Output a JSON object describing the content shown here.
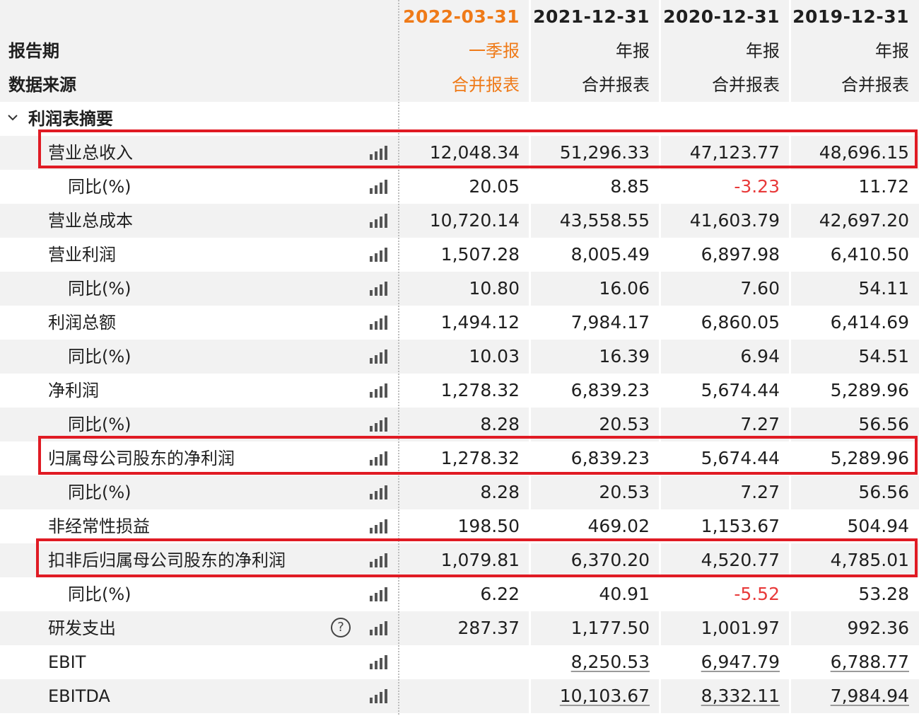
{
  "columns": [
    {
      "date": "2022-03-31",
      "report": "一季报",
      "source": "合并报表",
      "accent": true
    },
    {
      "date": "2021-12-31",
      "report": "年报",
      "source": "合并报表",
      "accent": false
    },
    {
      "date": "2020-12-31",
      "report": "年报",
      "source": "合并报表",
      "accent": false
    },
    {
      "date": "2019-12-31",
      "report": "年报",
      "source": "合并报表",
      "accent": false
    }
  ],
  "header": {
    "report_period_label": "报告期",
    "data_source_label": "数据来源",
    "section_label": "利润表摘要"
  },
  "rows": [
    {
      "label": "营业总收入",
      "values": [
        "12,048.34",
        "51,296.33",
        "47,123.77",
        "48,696.15"
      ]
    },
    {
      "label": "同比(%)",
      "values": [
        "20.05",
        "8.85",
        "-3.23",
        "11.72"
      ]
    },
    {
      "label": "营业总成本",
      "values": [
        "10,720.14",
        "43,558.55",
        "41,603.79",
        "42,697.20"
      ]
    },
    {
      "label": "营业利润",
      "values": [
        "1,507.28",
        "8,005.49",
        "6,897.98",
        "6,410.50"
      ]
    },
    {
      "label": "同比(%)",
      "values": [
        "10.80",
        "16.06",
        "7.60",
        "54.11"
      ]
    },
    {
      "label": "利润总额",
      "values": [
        "1,494.12",
        "7,984.17",
        "6,860.05",
        "6,414.69"
      ]
    },
    {
      "label": "同比(%)",
      "values": [
        "10.03",
        "16.39",
        "6.94",
        "54.51"
      ]
    },
    {
      "label": "净利润",
      "values": [
        "1,278.32",
        "6,839.23",
        "5,674.44",
        "5,289.96"
      ]
    },
    {
      "label": "同比(%)",
      "values": [
        "8.28",
        "20.53",
        "7.27",
        "56.56"
      ]
    },
    {
      "label": "归属母公司股东的净利润",
      "values": [
        "1,278.32",
        "6,839.23",
        "5,674.44",
        "5,289.96"
      ]
    },
    {
      "label": "同比(%)",
      "values": [
        "8.28",
        "20.53",
        "7.27",
        "56.56"
      ]
    },
    {
      "label": "非经常性损益",
      "values": [
        "198.50",
        "469.02",
        "1,153.67",
        "504.94"
      ]
    },
    {
      "label": "扣非后归属母公司股东的净利润",
      "values": [
        "1,079.81",
        "6,370.20",
        "4,520.77",
        "4,785.01"
      ]
    },
    {
      "label": "同比(%)",
      "values": [
        "6.22",
        "40.91",
        "-5.52",
        "53.28"
      ]
    },
    {
      "label": "研发支出",
      "values": [
        "287.37",
        "1,177.50",
        "1,001.97",
        "992.36"
      ]
    },
    {
      "label": "EBIT",
      "values": [
        "",
        "8,250.53",
        "6,947.79",
        "6,788.77"
      ]
    },
    {
      "label": "EBITDA",
      "values": [
        "",
        "10,103.67",
        "8,332.11",
        "7,984.94"
      ]
    }
  ],
  "help_glyph": "?",
  "colors": {
    "accent": "#ef7a18",
    "negative": "#e83a3a",
    "highlight": "#e01b24"
  }
}
